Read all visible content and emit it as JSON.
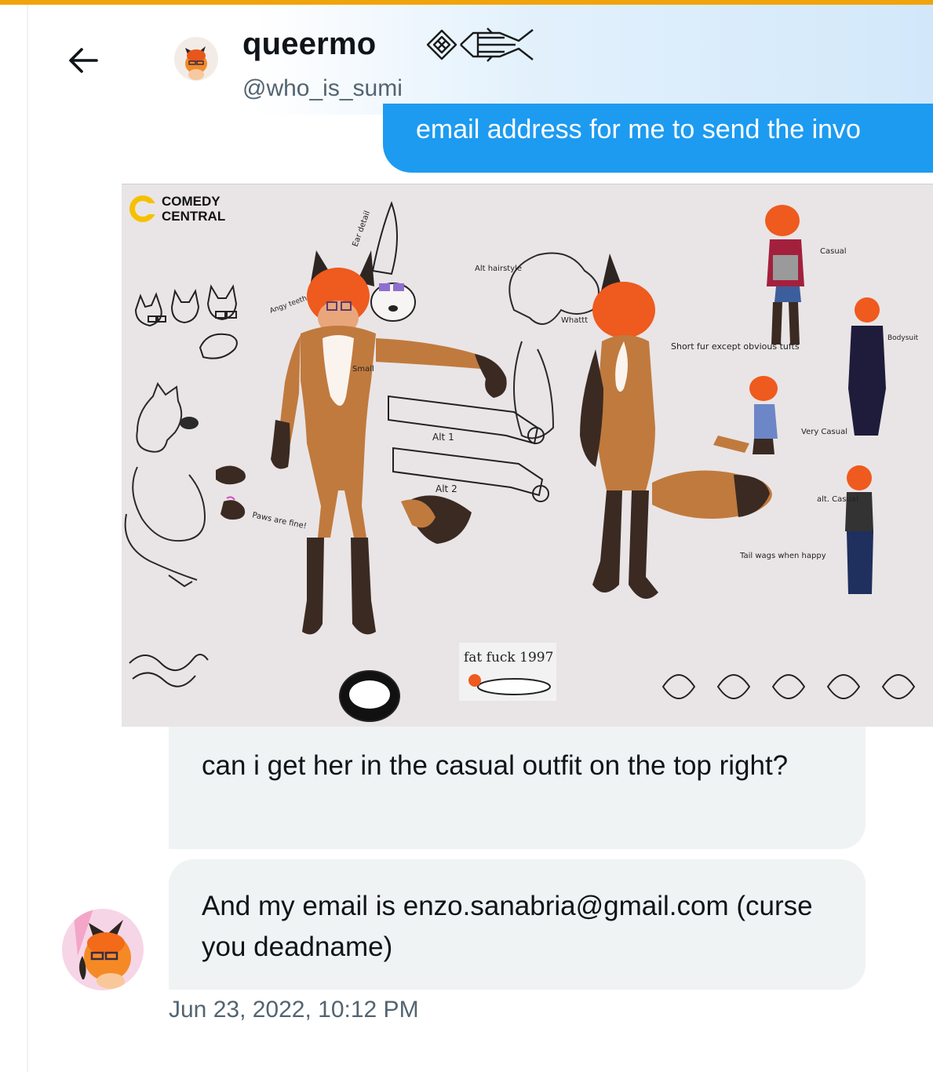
{
  "header": {
    "display_name": "queermo",
    "handle": "@who_is_sumi",
    "back_icon": "arrow-left-icon",
    "name_emoji": "custom-glyph-emoji"
  },
  "messages": {
    "outgoing": {
      "text": "email address for me to send the invo"
    },
    "attachment": {
      "network_logo_line1": "COMEDY",
      "network_logo_line2": "CENTRAL",
      "annotations": {
        "ear_detail": "Ear detail",
        "alt_hairstyle": "Alt hairstyle",
        "angry_teeth": "Angy teeth",
        "small": "Small",
        "whattt": "Whattt",
        "short_fur": "Short fur except obvious tufts",
        "casual": "Casual",
        "bodysuit": "Bodysuit",
        "very_casual": "Very Casual",
        "alt_casual": "alt. Casual",
        "alt1": "Alt 1",
        "alt2": "Alt 2",
        "paws": "Paws are fine!",
        "tail": "Tail wags when happy",
        "sticker": "fat fuck 1997"
      }
    },
    "incoming_1": {
      "text": "can i get her in the casual outfit on the top right?"
    },
    "incoming_2": {
      "text": "And my email is enzo.sanabria@gmail.com (curse you deadname)"
    },
    "timestamp": "Jun 23, 2022, 10:12 PM"
  },
  "colors": {
    "accent": "#1d9bf0",
    "bubble_in": "#eff3f4",
    "muted_text": "#536471",
    "top_rule": "#f0a30a",
    "fox_fur": "#c07a3e",
    "fox_hair": "#ef5a1e",
    "fox_dark": "#3a2a22"
  }
}
